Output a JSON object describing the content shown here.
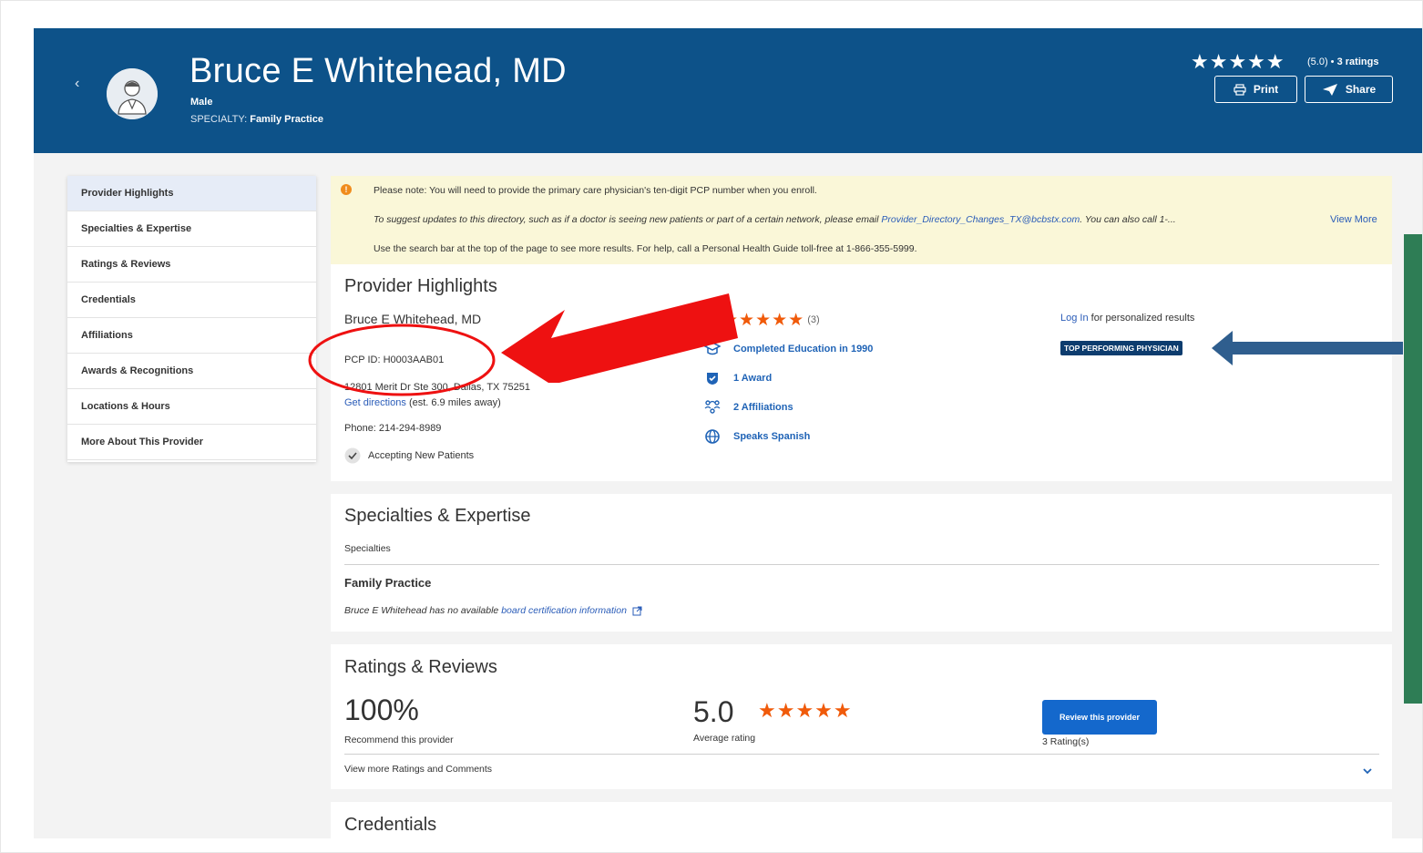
{
  "header": {
    "back_label": "‹",
    "name": "Bruce E Whitehead, MD",
    "gender": "Male",
    "specialty_label": "SPECIALTY:",
    "specialty": "Family Practice",
    "stars": "★★★★★",
    "rating_text": "(5.0) •",
    "rating_count": "3 ratings",
    "print_label": "Print",
    "share_label": "Share"
  },
  "sidebar": {
    "items": [
      {
        "label": "Provider Highlights"
      },
      {
        "label": "Specialties & Expertise"
      },
      {
        "label": "Ratings & Reviews"
      },
      {
        "label": "Credentials"
      },
      {
        "label": "Affiliations"
      },
      {
        "label": "Awards & Recognitions"
      },
      {
        "label": "Locations & Hours"
      },
      {
        "label": "More About This Provider"
      }
    ]
  },
  "notice": {
    "line1": "Please note: You will need to provide the primary care physician's ten-digit PCP number when you enroll.",
    "line2_prefix": "To suggest updates to this directory, such as if a doctor is seeing new patients or part of a certain network, please email",
    "line2_email": "Provider_Directory_Changes_TX@bcbstx.com",
    "line2_suffix": ". You can also call 1-...",
    "view_more": "View More",
    "line3": "Use the search bar at the top of the page to see more results. For help, call a Personal Health Guide toll-free at 1-866-355-5999."
  },
  "highlights": {
    "title": "Provider Highlights",
    "name": "Bruce E Whitehead, MD",
    "pcp_id": "PCP ID: H0003AAB01",
    "address": "12801 Merit Dr Ste 300, Dallas, TX 75251",
    "directions_link": "Get directions",
    "directions_distance": "(est. 6.9 miles away)",
    "phone": "Phone: 214-294-8989",
    "accepting": "Accepting New Patients",
    "stars": "★★★★★",
    "stars_count": "(3)",
    "education": "Completed Education in 1990",
    "awards": "1 Award",
    "affiliations": "2 Affiliations",
    "language": "Speaks Spanish",
    "login_link": "Log In",
    "login_suffix": "for personalized results",
    "badge": "TOP PERFORMING PHYSICIAN"
  },
  "specialties": {
    "title": "Specialties & Expertise",
    "subheading": "Specialties",
    "specialty": "Family Practice",
    "cert_prefix": "Bruce E Whitehead has no available",
    "cert_link": "board certification information"
  },
  "ratings": {
    "title": "Ratings & Reviews",
    "recommend_pct": "100%",
    "recommend_label": "Recommend this provider",
    "avg": "5.0",
    "avg_stars": "★★★★★",
    "avg_label": "Average rating",
    "review_button": "Review this provider",
    "rating_count": "3 Rating(s)",
    "more_link": "View more Ratings and Comments"
  },
  "credentials": {
    "title": "Credentials"
  },
  "colors": {
    "header_bg": "#0d5289",
    "accent_orange": "#f05a0a",
    "link_blue": "#2a5cb8",
    "annotation_red": "#ee1111",
    "annotation_blue": "#2f5e8e",
    "annotation_green": "#2e7d55"
  }
}
